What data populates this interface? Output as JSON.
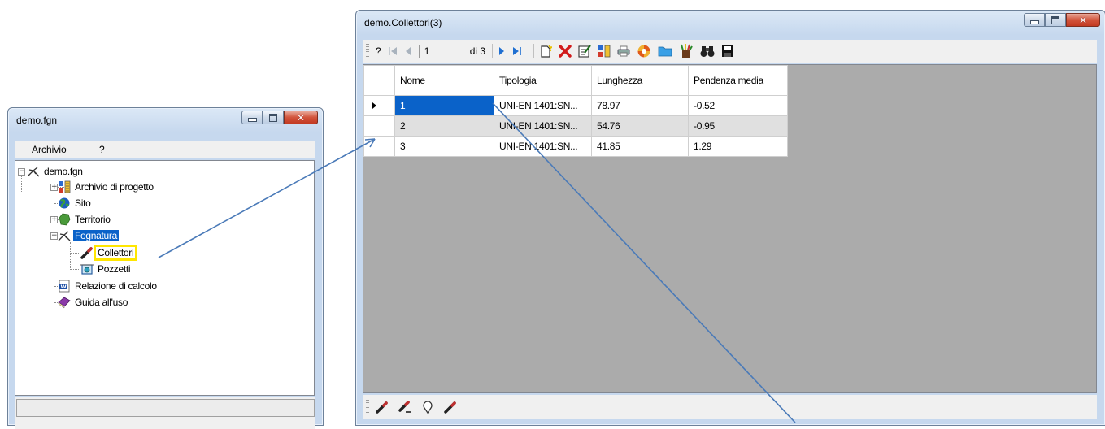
{
  "left_window": {
    "title": "demo.fgn",
    "menu": [
      "Archivio",
      "?"
    ],
    "tree": [
      {
        "label": "demo.fgn",
        "icon": "network-icon"
      },
      {
        "label": "Archivio di progetto",
        "icon": "database-icon"
      },
      {
        "label": "Sito",
        "icon": "globe-icon"
      },
      {
        "label": "Territorio",
        "icon": "map-icon"
      },
      {
        "label": "Fognatura",
        "icon": "network-icon",
        "selected": true
      },
      {
        "label": "Collettori",
        "icon": "pipe-icon",
        "highlighted": true
      },
      {
        "label": "Pozzetti",
        "icon": "manhole-icon"
      },
      {
        "label": "Relazione di calcolo",
        "icon": "word-document-icon"
      },
      {
        "label": "Guida all'uso",
        "icon": "book-icon"
      }
    ]
  },
  "right_window": {
    "title": "demo.Collettori(3)",
    "toolbar": {
      "help_label": "?",
      "position_value": "1",
      "of_total": "di 3",
      "tools": [
        "first-record-icon",
        "previous-record-icon",
        "next-record-icon",
        "last-record-icon",
        "new-record-icon",
        "delete-icon",
        "edit-icon",
        "database-icon",
        "print-icon",
        "help-lifebuoy-icon",
        "open-folder-icon",
        "paint-icon",
        "find-binoculars-icon",
        "save-icon"
      ]
    },
    "grid": {
      "columns": [
        "Nome",
        "Tipologia",
        "Lunghezza",
        "Pendenza media"
      ],
      "rows": [
        [
          "1",
          "UNI-EN 1401:SN...",
          "78.97",
          "-0.52"
        ],
        [
          "2",
          "UNI-EN 1401:SN...",
          "54.76",
          "-0.95"
        ],
        [
          "3",
          "UNI-EN 1401:SN...",
          "41.85",
          "1.29"
        ]
      ],
      "current_row": 0
    },
    "bottom_tools": [
      "pipe-tool-icon",
      "pipe-edit-icon",
      "node-icon",
      "pipe-tool-2-icon"
    ]
  },
  "colors": {
    "selection": "#0a62c9",
    "highlight": "#ffe600",
    "arrow": "#4a7ab8",
    "grid_bg": "#ababab"
  }
}
